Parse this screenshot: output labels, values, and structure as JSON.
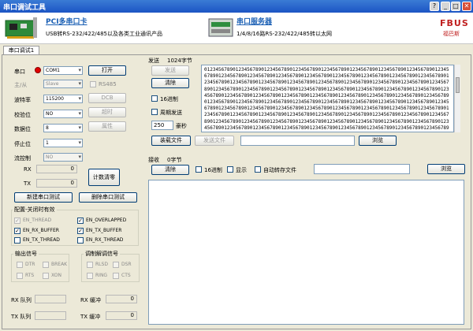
{
  "window": {
    "title": "串口调试工具",
    "buttons": {
      "help": "?",
      "minimize": "_",
      "maximize": "□",
      "close": "✕"
    }
  },
  "banner": {
    "ad1": {
      "title": "PCI多串口卡",
      "subtitle": "USB转RS-232/422/485以及各类工业通讯产品"
    },
    "ad2": {
      "title": "串口服务器",
      "subtitle": "1/4/8/16路RS-232/422/485转以太网"
    },
    "logo": {
      "text": "FBUS",
      "subtext": "福巴斯"
    }
  },
  "tab": {
    "label": "串口调试1"
  },
  "settings": {
    "port_label": "串口",
    "port_value": "COM1",
    "master_label": "主/从",
    "master_value": "Slave",
    "baud_label": "波特率",
    "baud_value": "115200",
    "parity_label": "校验位",
    "parity_value": "NO",
    "data_label": "数据位",
    "data_value": "8",
    "stop_label": "停止位",
    "stop_value": "1",
    "flow_label": "流控制",
    "flow_value": "NO",
    "open_button": "打开",
    "rs485_label": "RS485",
    "dcb_button": "DCB",
    "timeout_button": "超时",
    "attr_button": "属性"
  },
  "counters": {
    "rx_label": "RX",
    "rx_value": "0",
    "tx_label": "TX",
    "tx_value": "0",
    "clear_button": "计数清零"
  },
  "actions": {
    "new_test": "新建串口测试",
    "delete_test": "删除串口测试"
  },
  "config": {
    "title": "配置-关闭时有效",
    "items": [
      {
        "label": "EN_THREAD",
        "checked": true,
        "disabled": true
      },
      {
        "label": "EN_OVERLAPPED",
        "checked": true,
        "disabled": false
      },
      {
        "label": "EN_RX_BUFFER",
        "checked": true,
        "disabled": false
      },
      {
        "label": "EN_TX_BUFFER",
        "checked": true,
        "disabled": false
      },
      {
        "label": "EN_TX_THREAD",
        "checked": false,
        "disabled": false
      },
      {
        "label": "EN_RX_THREAD",
        "checked": false,
        "disabled": false
      }
    ]
  },
  "output_signals": {
    "title": "输出信号",
    "items": [
      "DTR",
      "BREAK",
      "RTS",
      "XON"
    ]
  },
  "modem_signals": {
    "title": "调制解调信号",
    "items": [
      "RLSD",
      "DSR",
      "RING",
      "CTS"
    ]
  },
  "queues": {
    "rx_queue_label": "RX 队列",
    "rx_queue_value": "",
    "rx_buffer_label": "RX 缓冲",
    "rx_buffer_value": "0",
    "tx_queue_label": "TX 队列",
    "tx_queue_value": "",
    "tx_buffer_label": "TX 缓冲",
    "tx_buffer_value": "0"
  },
  "send": {
    "header_label": "发送",
    "byte_count": "1024字节",
    "send_button": "发送",
    "clear_button": "清除",
    "hex_label": "16进制",
    "periodic_label": "周期发送",
    "period_value": "250",
    "period_unit": "豪秒",
    "load_file_button": "装载文件",
    "send_file_button": "发送文件",
    "file_path": "",
    "browse_button": "浏览",
    "content": "0123456789012345678901234567890123456789012345678901234567890123456789012345678901234567890123456789012345678901234567890123456789012345678901234567890123456789012345678901234567890123456789012345678901234567890123456789012345678901234567890123456789012345678901234567890123456789012345678901234567890123456789012345678901234567890123456789012345678901234567890123456789012345678901234567890123456789012345678901234567890123456789012345678901234567890123456789012345678901234567890123456789012345678901234567890123456789012345678901234567890123456789012345678901234567890123456789012345678901234567890123456789012345678901234567890123456789012345678901234567890123456789012345678901234567890123456789012345678901234567890123456789012345678901234567890123456789012345678901234567890123456789012345678901234567890123456789012345678901234567890123456789012345678901234567890123456789012345678901234567890123456789012345678901234567890123456789012345678901234567890123456789012345678901234567890123456789012345678901234567890123456789012345678901234567890123456789012345678901234567890123456789012345678901234567890123456789012345678901234567890123456789012345678901234567890123456789012345678901234567890123"
  },
  "receive": {
    "header_label": "接收",
    "byte_count": "0字节",
    "clear_button": "清除",
    "hex_label": "16进制",
    "display_label": "显示",
    "autosave_label": "自动转存文件",
    "file_path": "",
    "browse_button": "浏览",
    "content": ""
  },
  "colors": {
    "title_bar": "#1c55c4",
    "ad_title": "#1a5fb4",
    "port_indicator": "#e00000"
  }
}
